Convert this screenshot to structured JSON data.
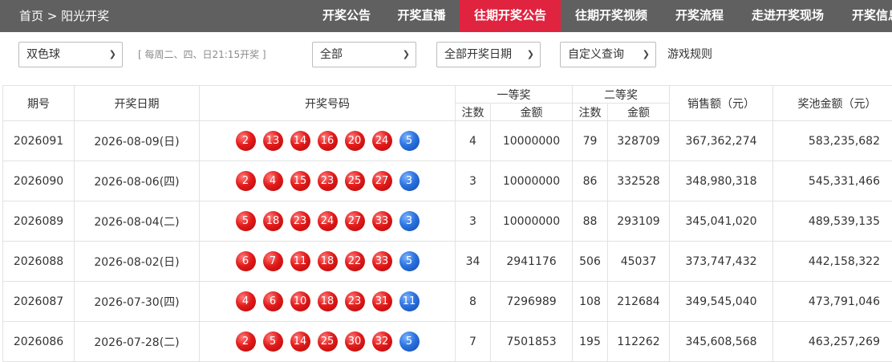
{
  "breadcrumb": {
    "home": "首页",
    "separator": ">",
    "current": "阳光开奖"
  },
  "nav": {
    "items": [
      {
        "label": "开奖公告"
      },
      {
        "label": "开奖直播"
      },
      {
        "label": "往期开奖公告",
        "active": true
      },
      {
        "label": "往期开奖视频"
      },
      {
        "label": "开奖流程"
      },
      {
        "label": "走进开奖现场"
      },
      {
        "label": "开奖信息"
      }
    ],
    "active_color": "#e0233f",
    "bar_color": "#606060"
  },
  "filters": {
    "game": "双色球",
    "schedule_note": "[ 每周二、四、日21:15开奖 ]",
    "range": "全部",
    "date": "全部开奖日期",
    "custom": "自定义查询",
    "rules_link": "游戏规则",
    "chevron_icon": "chevron-down-icon"
  },
  "table": {
    "headers": {
      "issue": "期号",
      "date": "开奖日期",
      "numbers": "开奖号码",
      "first_prize": "一等奖",
      "second_prize": "二等奖",
      "count": "注数",
      "amount": "金额",
      "sales": "销售额（元）",
      "pool": "奖池金额（元）"
    },
    "ball_colors": {
      "red": "#e31b1b",
      "blue": "#2a73e0"
    },
    "rows": [
      {
        "issue": "2026091",
        "date": "2026-08-09(日)",
        "reds": [
          "2",
          "13",
          "14",
          "16",
          "20",
          "24"
        ],
        "blue": "5",
        "first_count": "4",
        "first_amount": "10000000",
        "second_count": "79",
        "second_amount": "328709",
        "sales": "367,362,274",
        "pool": "583,235,682"
      },
      {
        "issue": "2026090",
        "date": "2026-08-06(四)",
        "reds": [
          "2",
          "4",
          "15",
          "23",
          "25",
          "27"
        ],
        "blue": "3",
        "first_count": "3",
        "first_amount": "10000000",
        "second_count": "86",
        "second_amount": "332528",
        "sales": "348,980,318",
        "pool": "545,331,466"
      },
      {
        "issue": "2026089",
        "date": "2026-08-04(二)",
        "reds": [
          "5",
          "18",
          "23",
          "24",
          "27",
          "33"
        ],
        "blue": "3",
        "first_count": "3",
        "first_amount": "10000000",
        "second_count": "88",
        "second_amount": "293109",
        "sales": "345,041,020",
        "pool": "489,539,135"
      },
      {
        "issue": "2026088",
        "date": "2026-08-02(日)",
        "reds": [
          "6",
          "7",
          "11",
          "18",
          "22",
          "33"
        ],
        "blue": "5",
        "first_count": "34",
        "first_amount": "2941176",
        "second_count": "506",
        "second_amount": "45037",
        "sales": "373,747,432",
        "pool": "442,158,322"
      },
      {
        "issue": "2026087",
        "date": "2026-07-30(四)",
        "reds": [
          "4",
          "6",
          "10",
          "18",
          "23",
          "31"
        ],
        "blue": "11",
        "first_count": "8",
        "first_amount": "7296989",
        "second_count": "108",
        "second_amount": "212684",
        "sales": "349,545,040",
        "pool": "473,791,046"
      },
      {
        "issue": "2026086",
        "date": "2026-07-28(二)",
        "reds": [
          "2",
          "5",
          "14",
          "25",
          "30",
          "32"
        ],
        "blue": "5",
        "first_count": "7",
        "first_amount": "7501853",
        "second_count": "195",
        "second_amount": "112262",
        "sales": "345,608,568",
        "pool": "463,257,269"
      }
    ]
  }
}
